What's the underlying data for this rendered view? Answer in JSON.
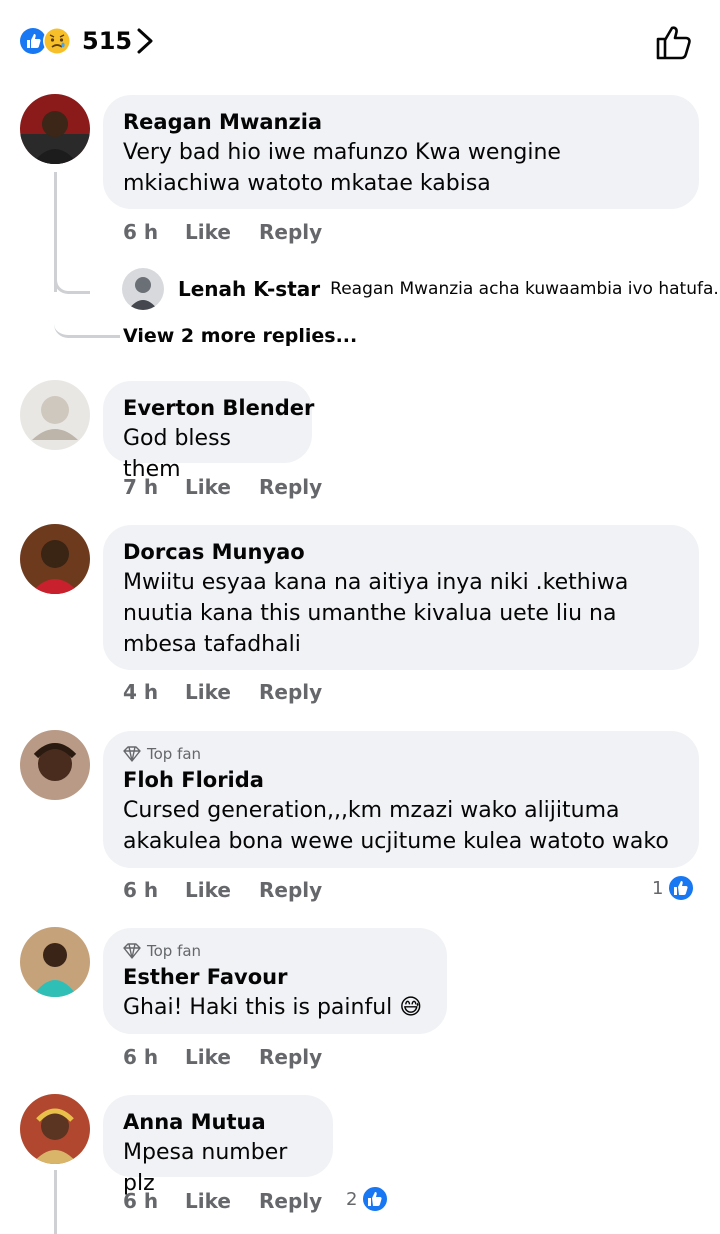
{
  "header": {
    "reaction_count": "515",
    "reactions": [
      "like-icon",
      "sad-icon"
    ]
  },
  "comments": [
    {
      "name": "Reagan Mwanzia",
      "text": "Very bad hio iwe mafunzo Kwa wengine mkiachiwa watoto mkatae kabisa",
      "time": "6 h",
      "like": "Like",
      "reply": "Reply"
    },
    {
      "name": "Everton Blender",
      "text": "God bless them",
      "time": "7 h",
      "like": "Like",
      "reply": "Reply"
    },
    {
      "name": "Dorcas Munyao",
      "text": "Mwiitu esyaa kana na aitiya inya niki .kethiwa nuutia kana this umanthe kivalua uete liu na mbesa tafadhali",
      "time": "4 h",
      "like": "Like",
      "reply": "Reply"
    },
    {
      "badge": "Top fan",
      "name": "Floh Florida",
      "text": "Cursed generation,,,km mzazi wako alijituma akakulea bona wewe ucjitume kulea watoto wako",
      "time": "6 h",
      "like": "Like",
      "reply": "Reply",
      "reaction_count": "1"
    },
    {
      "badge": "Top fan",
      "name": "Esther Favour",
      "text": "Ghai! Haki this is painful 😅",
      "time": "6 h",
      "like": "Like",
      "reply": "Reply"
    },
    {
      "name": "Anna Mutua",
      "text": "Mpesa number plz",
      "time": "6 h",
      "like": "Like",
      "reply": "Reply",
      "reaction_count": "2"
    }
  ],
  "reply_preview": {
    "name": "Lenah K-star",
    "text": "Reagan Mwanzia acha kuwaambia ivo hatufa..."
  },
  "view_more": "View 2 more replies...",
  "colors": {
    "bubble": "#f0f2f5",
    "secondary_text": "#65676b",
    "like_blue": "#1877f2",
    "thread_line": "#ced0d4"
  }
}
